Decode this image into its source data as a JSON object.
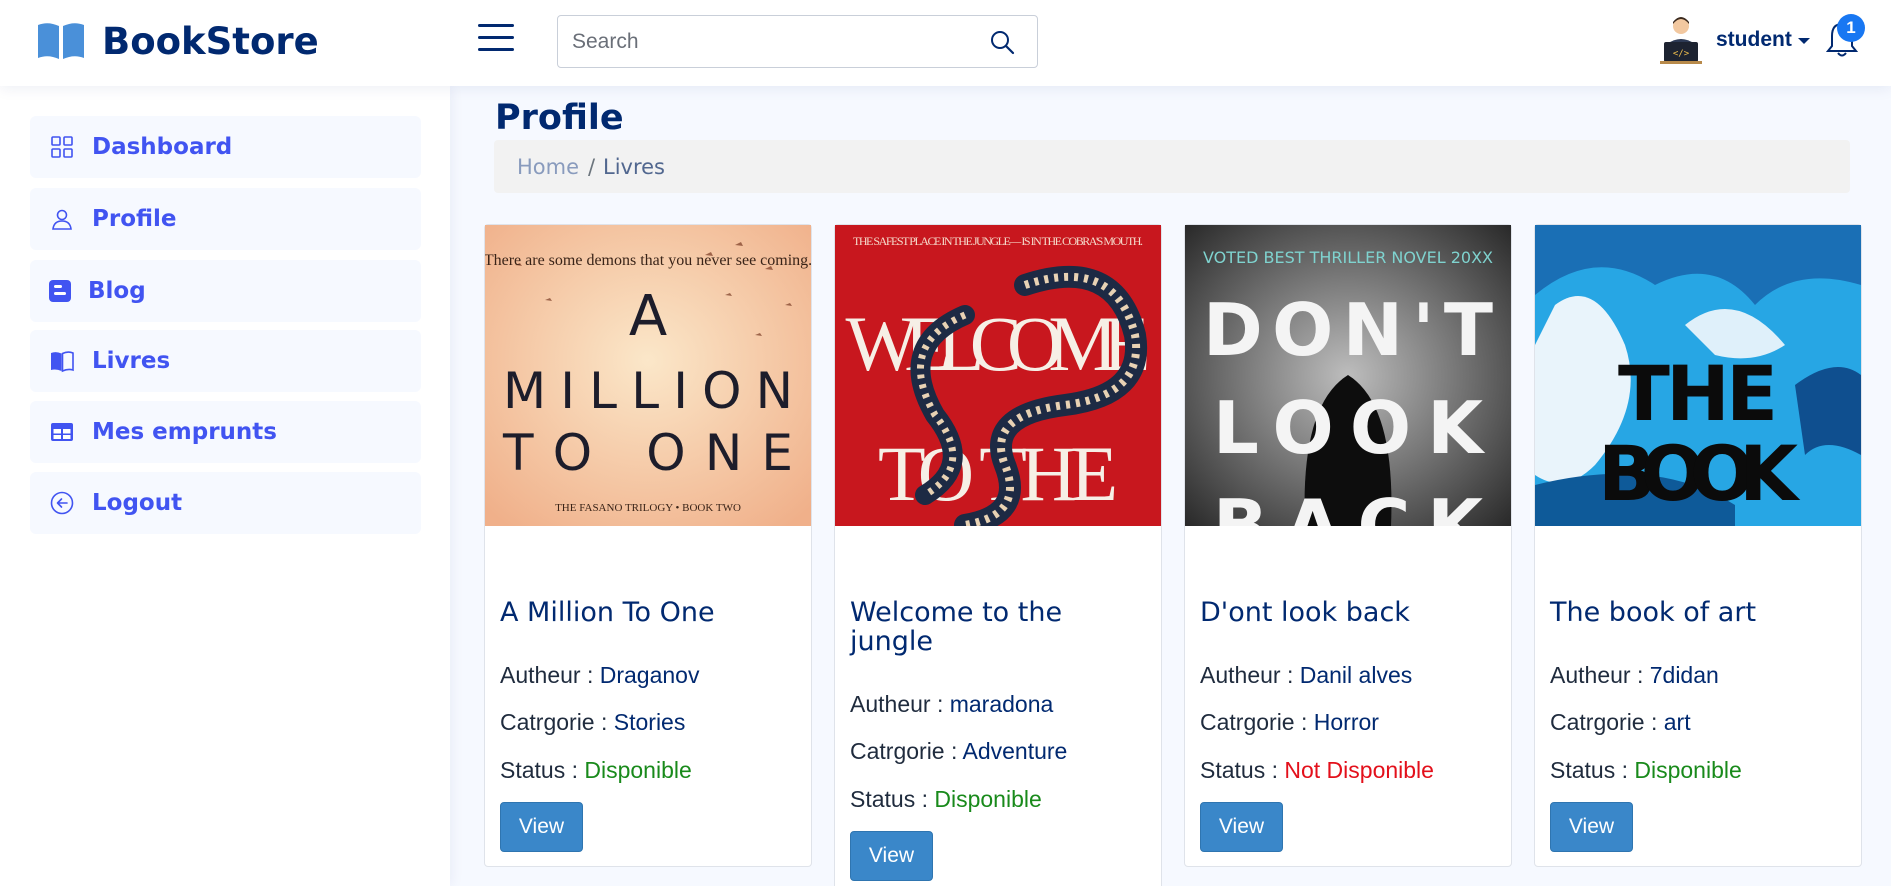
{
  "header": {
    "brand": "BookStore",
    "search_placeholder": "Search",
    "user_name": "student",
    "notification_count": "1"
  },
  "sidebar": {
    "items": [
      {
        "label": "Dashboard",
        "icon": "grid-icon"
      },
      {
        "label": "Profile",
        "icon": "person-icon"
      },
      {
        "label": "Blog",
        "icon": "blogger-icon"
      },
      {
        "label": "Livres",
        "icon": "book-icon"
      },
      {
        "label": "Mes emprunts",
        "icon": "table-icon"
      },
      {
        "label": "Logout",
        "icon": "arrow-left-circle-icon"
      }
    ]
  },
  "main": {
    "page_title": "Profile",
    "breadcrumb": {
      "home": "Home",
      "separator": "/",
      "current": "Livres"
    },
    "labels": {
      "author": "Autheur :",
      "category": "Catrgorie :",
      "status": "Status :",
      "view": "View"
    },
    "books": [
      {
        "title": "A Million To One",
        "author": "Draganov",
        "category": "Stories",
        "status": "Disponible",
        "cover": {
          "tagline": "There are some demons that you never see coming.",
          "lines": [
            "A",
            "MILLION",
            "TO ONE"
          ],
          "footer": "THE FASANO TRILOGY • BOOK TWO"
        }
      },
      {
        "title": "Welcome to the jungle",
        "author": "maradona",
        "category": "Adventure",
        "status": "Disponible",
        "cover": {
          "tagline": "THE SAFEST PLACE IN THE JUNGLE— IS IN THE COBRA'S MOUTH.",
          "lines": [
            "WELCOME",
            "TO THE"
          ]
        }
      },
      {
        "title": "D'ont look back",
        "author": "Danil alves",
        "category": "Horror",
        "status": "Not Disponible",
        "cover": {
          "tagline": "VOTED BEST THRILLER NOVEL 20XX",
          "lines": [
            "DON'T",
            "LOOK",
            "BACK"
          ]
        }
      },
      {
        "title": "The book of art",
        "author": "7didan",
        "category": "art",
        "status": "Disponible",
        "cover": {
          "lines": [
            "THE",
            "BOOK"
          ]
        }
      }
    ]
  },
  "colors": {
    "brand": "#012970",
    "accent": "#4154f1",
    "button": "#3a87c9",
    "available": "#198a1b",
    "unavailable": "#e3101b"
  }
}
